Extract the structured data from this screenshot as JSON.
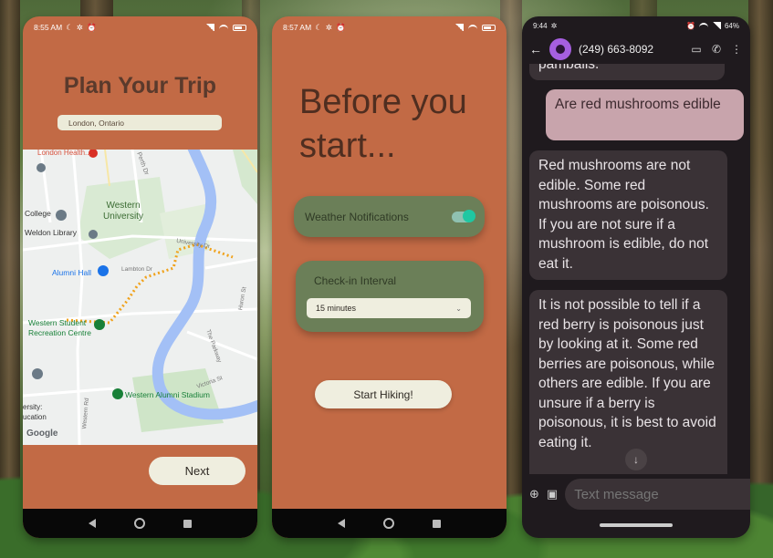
{
  "phone1": {
    "status": {
      "time": "8:55 AM",
      "battery": "32"
    },
    "title": "Plan Your Trip",
    "location_value": "London, Ontario",
    "map_labels": {
      "london_health": "London Health...",
      "western_university": "Western University",
      "college": "College",
      "weldon_library": "Weldon Library",
      "alumni_hall": "Alumni Hall",
      "western_student": "Western Student",
      "recreation_centre": "Recreation Centre",
      "western_alumni_stadium": "Western Alumni Stadium",
      "university_education": "ersity: ucation",
      "perth_dr": "Perth Dr",
      "university_dr": "University Dr",
      "lambton_dr": "Lambton Dr",
      "huron_st": "Huron St",
      "the_parkway": "The Parkway",
      "victoria_st": "Victoria St",
      "western_rd": "Western Rd",
      "google": "Google"
    },
    "next_label": "Next"
  },
  "phone2": {
    "status": {
      "time": "8:57 AM",
      "battery": "32"
    },
    "title": "Before you start...",
    "weather_label": "Weather Notifications",
    "weather_enabled": true,
    "checkin_label": "Check-in Interval",
    "checkin_value": "15 minutes",
    "start_label": "Start Hiking!"
  },
  "phone3": {
    "status": {
      "time": "9:44",
      "battery": "64%"
    },
    "contact": "(249) 663-8092",
    "messages": [
      {
        "direction": "in",
        "text": "pambalis."
      },
      {
        "direction": "out",
        "text": "Are red mushrooms edible"
      },
      {
        "direction": "in",
        "text": "Red mushrooms are not edible. Some red mushrooms are poisonous. If you are not sure if a mushroom is edible, do not eat it."
      },
      {
        "direction": "in",
        "text": "It is not possible to tell if a red berry is poisonous just by looking at it. Some red berries are poisonous, while others are edible. If you are unsure if a berry is poisonous, it is best to avoid eating it."
      }
    ],
    "composer_placeholder": "Text message"
  },
  "colors": {
    "app_bg": "#c26a45",
    "card_green": "#6b7f58",
    "toggle_on": "#1fc7a2",
    "out_bubble": "#c8a4ac",
    "in_bubble": "#3a3236"
  },
  "icons": [
    "moon-icon",
    "settings-icon",
    "alarm-icon",
    "signal-icon",
    "wifi-icon",
    "battery-icon",
    "back-arrow-icon",
    "avatar-icon",
    "video-call-icon",
    "phone-call-icon",
    "more-vert-icon",
    "add-icon",
    "gallery-icon",
    "emoji-icon",
    "mic-icon",
    "arrow-down-icon",
    "map-pin-icon",
    "chevron-down-icon",
    "nav-back-icon",
    "nav-home-icon",
    "nav-recents-icon"
  ]
}
